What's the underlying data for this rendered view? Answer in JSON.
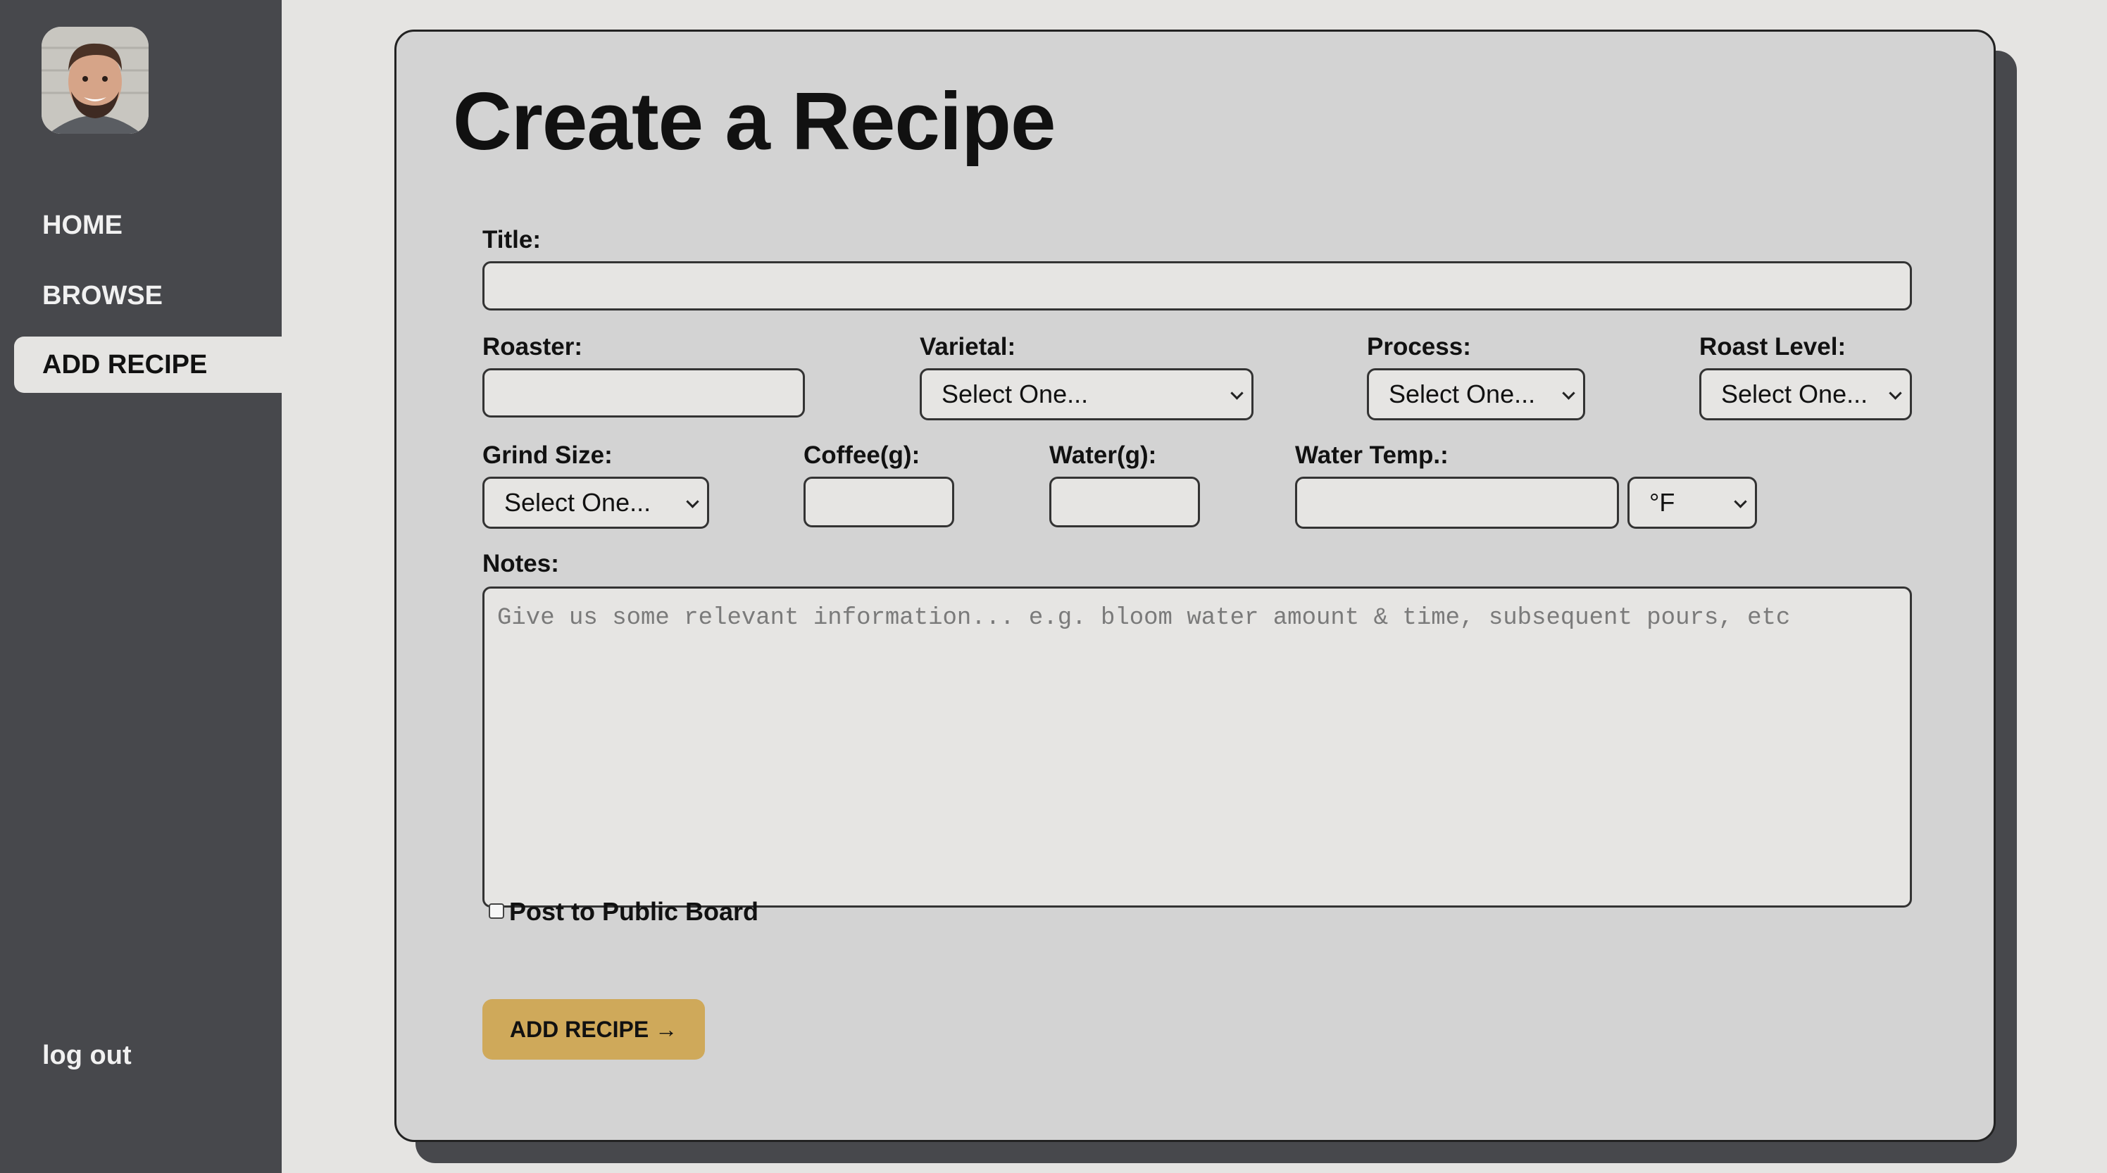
{
  "sidebar": {
    "avatar_alt": "User avatar",
    "nav": {
      "home": "HOME",
      "browse": "BROWSE",
      "add_recipe": "ADD RECIPE"
    },
    "logout": "log out"
  },
  "form": {
    "title": "Create a Recipe",
    "labels": {
      "title": "Title:",
      "roaster": "Roaster:",
      "varietal": "Varietal:",
      "process": "Process:",
      "roast_level": "Roast Level:",
      "grind_size": "Grind Size:",
      "coffee": "Coffee(g):",
      "water": "Water(g):",
      "water_temp": "Water Temp.:",
      "notes": "Notes:"
    },
    "values": {
      "title": "",
      "roaster": "",
      "coffee": "",
      "water": "",
      "water_temp": ""
    },
    "selects": {
      "varietal": "Select One...",
      "process": "Select One...",
      "roast_level": "Select One...",
      "grind_size": "Select One...",
      "temp_unit": "°F"
    },
    "notes_placeholder": "Give us some relevant information... e.g. bloom water amount & time, subsequent pours, etc",
    "post_public_label": "Post to Public Board",
    "post_public_checked": false,
    "submit_label": "ADD RECIPE →"
  },
  "colors": {
    "sidebar_bg": "#47484c",
    "page_bg": "#e5e4e2",
    "card_bg": "#d3d3d3",
    "accent_button": "#cfa95a"
  }
}
